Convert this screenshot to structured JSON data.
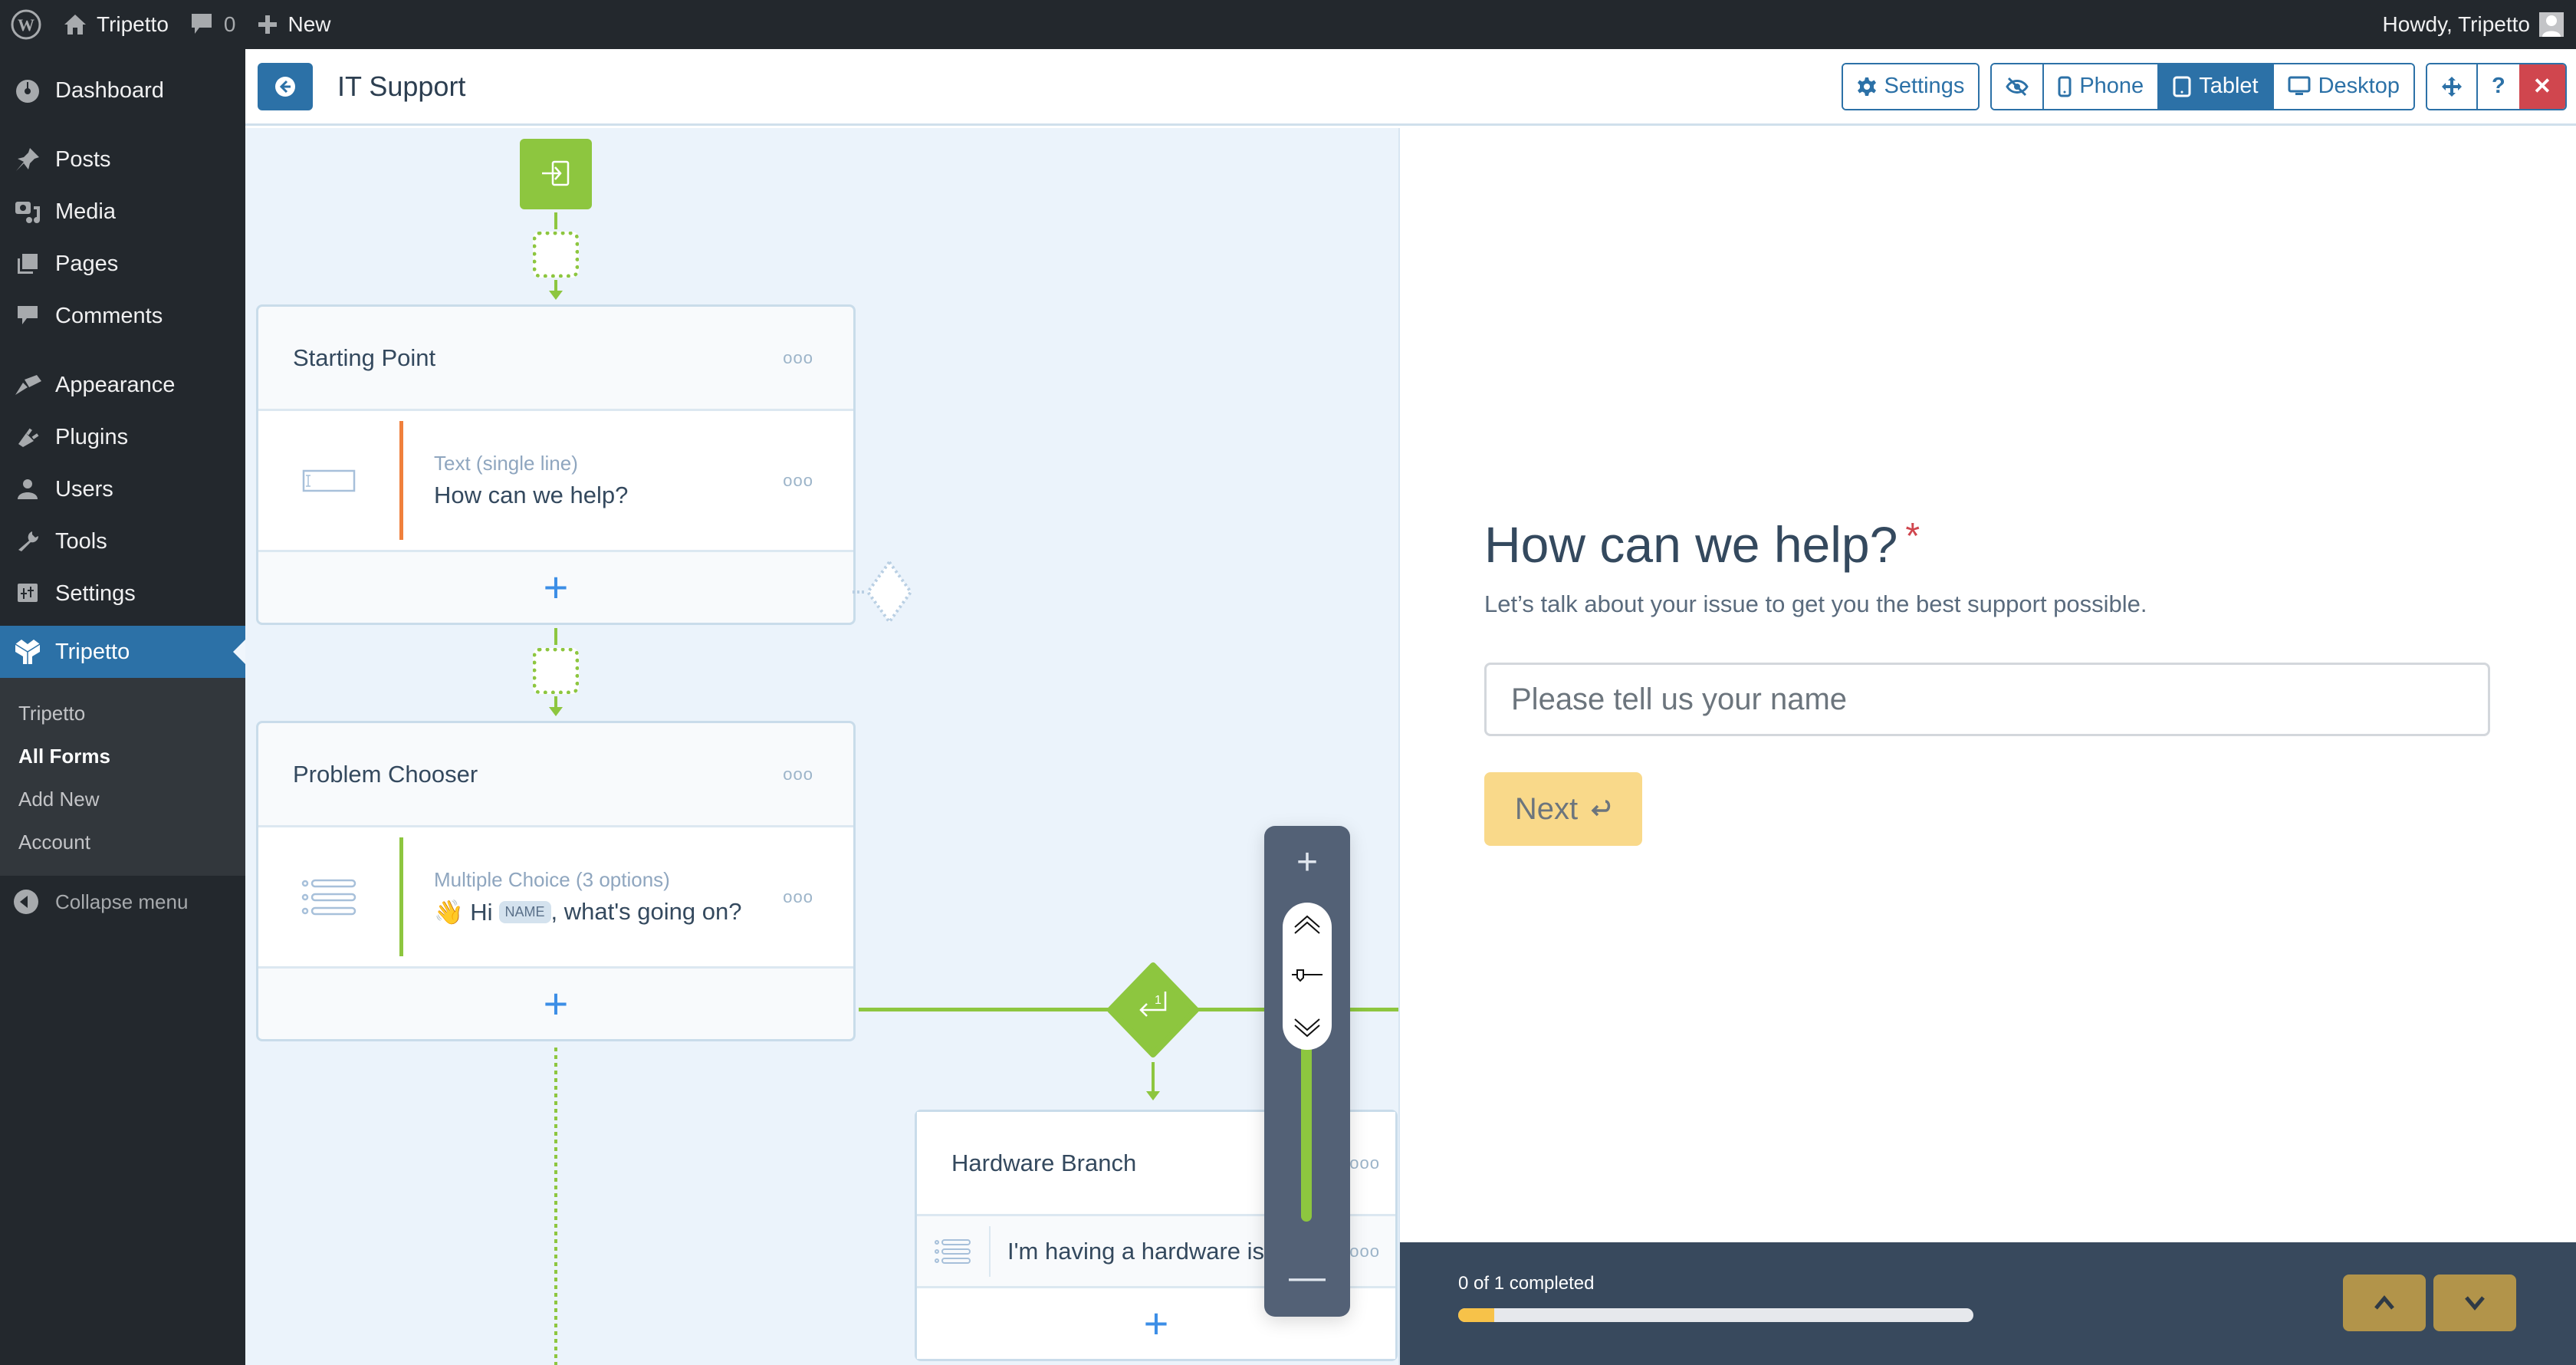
{
  "adminbar": {
    "site_name": "Tripetto",
    "comments_count": "0",
    "new_label": "New",
    "greeting": "Howdy, Tripetto"
  },
  "sidebar": {
    "items": [
      {
        "label": "Dashboard",
        "icon": "dashboard-icon"
      },
      {
        "label": "Posts",
        "icon": "pin-icon"
      },
      {
        "label": "Media",
        "icon": "media-icon"
      },
      {
        "label": "Pages",
        "icon": "pages-icon"
      },
      {
        "label": "Comments",
        "icon": "comment-icon"
      },
      {
        "label": "Appearance",
        "icon": "paintbrush-icon"
      },
      {
        "label": "Plugins",
        "icon": "plug-icon"
      },
      {
        "label": "Users",
        "icon": "user-icon"
      },
      {
        "label": "Tools",
        "icon": "wrench-icon"
      },
      {
        "label": "Settings",
        "icon": "settings-sliders-icon"
      },
      {
        "label": "Tripetto",
        "icon": "tripetto-logo-icon",
        "active": true
      }
    ],
    "submenu": [
      {
        "label": "Tripetto"
      },
      {
        "label": "All Forms",
        "current": true
      },
      {
        "label": "Add New"
      },
      {
        "label": "Account"
      }
    ],
    "collapse_label": "Collapse menu"
  },
  "formbar": {
    "title": "IT Support",
    "settings_label": "Settings",
    "phone_label": "Phone",
    "tablet_label": "Tablet",
    "desktop_label": "Desktop",
    "help_label": "?",
    "close_label": "✕",
    "active_device": "Tablet"
  },
  "builder": {
    "sections": [
      {
        "title": "Starting Point",
        "block_type": "Text (single line)",
        "block_name": "How can we help?",
        "accent": "#f0803c"
      },
      {
        "title": "Problem Chooser",
        "block_type": "Multiple Choice (3 options)",
        "block_name_prefix": "👋 Hi",
        "block_name_tag": "NAME",
        "block_name_suffix": ", what's going on?",
        "accent": "#8dc63f"
      },
      {
        "title": "Hardware Branch",
        "block_name": "I'm having a hardware is..."
      }
    ],
    "branch_badge": "1",
    "menu_dots": "ooo"
  },
  "preview": {
    "question": "How can we help?",
    "required_mark": "*",
    "description": "Let’s talk about your issue to get you the best support possible.",
    "input_placeholder": "Please tell us your name",
    "input_value": "",
    "next_label": "Next",
    "status": "0 of 1 completed",
    "progress_fraction": 0.07
  },
  "colors": {
    "wp_blue": "#2c71a7",
    "green": "#8dc63f",
    "close_red": "#d0464e",
    "next_yellow": "#f9d98a"
  }
}
